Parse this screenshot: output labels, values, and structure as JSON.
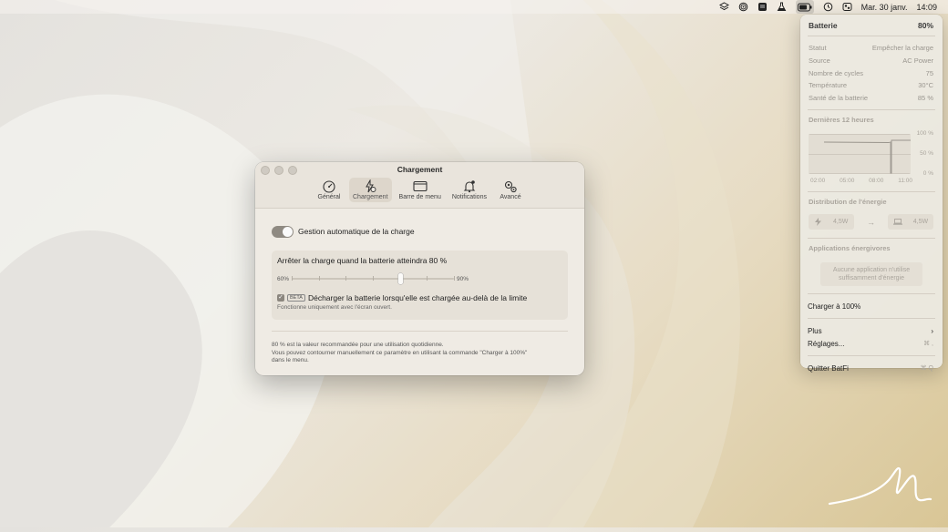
{
  "menubar": {
    "date": "Mar. 30 janv.",
    "time": "14:09"
  },
  "window": {
    "title": "Chargement",
    "tabs": [
      {
        "label": "Général",
        "icon": "gauge-icon",
        "active": false
      },
      {
        "label": "Chargement",
        "icon": "charging-icon",
        "active": true
      },
      {
        "label": "Barre de menu",
        "icon": "menubar-icon",
        "active": false
      },
      {
        "label": "Notifications",
        "icon": "bell-icon",
        "active": false
      },
      {
        "label": "Avancé",
        "icon": "gears-icon",
        "active": false
      }
    ],
    "auto_manage_label": "Gestion automatique de la charge",
    "limit_title": "Arrêter la charge quand la batterie atteindra 80 %",
    "slider": {
      "min_label": "60%",
      "max_label": "90%",
      "value": 80,
      "min": 60,
      "max": 90
    },
    "beta_label": "BETA",
    "discharge_label": "Décharger la batterie lorsqu'elle est chargée au-delà de la limite",
    "discharge_note": "Fonctionne uniquement avec l'écran ouvert.",
    "footer": [
      "80 % est la valeur recommandée pour une utilisation quotidienne.",
      "Vous pouvez contourner manuellement ce paramètre en utilisant la commande \"Charger à 100%\"",
      "dans le menu."
    ]
  },
  "battery_menu": {
    "title": "Batterie",
    "percent": "80%",
    "stats": [
      {
        "label": "Statut",
        "value": "Empêcher la charge"
      },
      {
        "label": "Source",
        "value": "AC Power"
      },
      {
        "label": "Nombre de cycles",
        "value": "75"
      },
      {
        "label": "Température",
        "value": "30°C"
      },
      {
        "label": "Santé de la batterie",
        "value": "85 %"
      }
    ],
    "history_title": "Dernières 12 heures",
    "history_y_labels": [
      "100 %",
      "50 %",
      "0 %"
    ],
    "history_x_labels": [
      "02:00",
      "05:00",
      "08:00",
      "11:00"
    ],
    "energy_title": "Distribution de l'énergie",
    "energy_in": "4,5W",
    "energy_out": "4,5W",
    "apps_title": "Applications énergivores",
    "apps_empty": "Aucune application n'utilise suffisamment d'énergie",
    "charge_full": "Charger à 100%",
    "more": "Plus",
    "more_chevron": "›",
    "settings": "Réglages...",
    "settings_shortcut": "⌘ ,",
    "quit": "Quitter BatFi",
    "quit_shortcut": "⌘ Q"
  }
}
